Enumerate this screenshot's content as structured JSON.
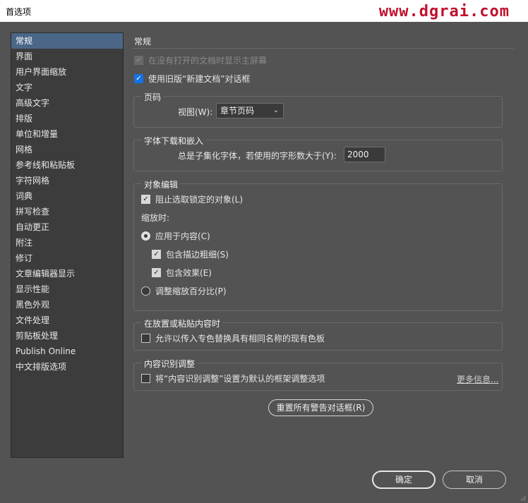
{
  "window": {
    "title": "首选项",
    "watermark": "www.dgrai.com"
  },
  "sidebar": {
    "items": [
      {
        "label": "常规",
        "selected": true
      },
      {
        "label": "界面"
      },
      {
        "label": "用户界面缩放"
      },
      {
        "label": "文字"
      },
      {
        "label": "高级文字"
      },
      {
        "label": "排版"
      },
      {
        "label": "单位和增量"
      },
      {
        "label": "网格"
      },
      {
        "label": "参考线和粘贴板"
      },
      {
        "label": "字符网格"
      },
      {
        "label": "词典"
      },
      {
        "label": "拼写检查"
      },
      {
        "label": "自动更正"
      },
      {
        "label": "附注"
      },
      {
        "label": "修订"
      },
      {
        "label": "文章编辑器显示"
      },
      {
        "label": "显示性能"
      },
      {
        "label": "黑色外观"
      },
      {
        "label": "文件处理"
      },
      {
        "label": "剪贴板处理"
      },
      {
        "label": "Publish Online"
      },
      {
        "label": "中文排版选项"
      }
    ]
  },
  "main": {
    "section_title": "常规",
    "show_start_screen": {
      "label": "在没有打开的文档时显示主屏幕",
      "checked": true,
      "disabled": true
    },
    "legacy_new_doc": {
      "label": "使用旧版“新建文档”对话框",
      "checked": true
    },
    "page_numbering": {
      "title": "页码",
      "view_label": "视图(W):",
      "view_value": "章节页码"
    },
    "font_download": {
      "title": "字体下载和嵌入",
      "subset_label": "总是子集化字体，若使用的字形数大于(Y):",
      "subset_value": "2000"
    },
    "object_editing": {
      "title": "对象编辑",
      "prevent_locked": {
        "label": "阻止选取锁定的对象(L)",
        "checked": true
      },
      "when_scaling": "缩放时:",
      "apply_to_content": {
        "label": "应用于内容(C)",
        "selected": true
      },
      "include_stroke": {
        "label": "包含描边粗细(S)",
        "checked": true
      },
      "include_effects": {
        "label": "包含效果(E)",
        "checked": true
      },
      "adjust_percent": {
        "label": "调整缩放百分比(P)",
        "selected": false
      }
    },
    "place_paste": {
      "title": "在放置或粘贴内容时",
      "replace_swatches": {
        "label": "允许以传入专色替换具有相同名称的现有色板",
        "checked": false
      }
    },
    "content_aware": {
      "title": "内容识别调整",
      "set_default": {
        "label": "将“内容识别调整”设置为默认的框架调整选项",
        "checked": false
      },
      "more_info": "更多信息..."
    },
    "reset_dialogs": "重置所有警告对话框(R)"
  },
  "footer": {
    "ok": "确定",
    "cancel": "取消"
  }
}
